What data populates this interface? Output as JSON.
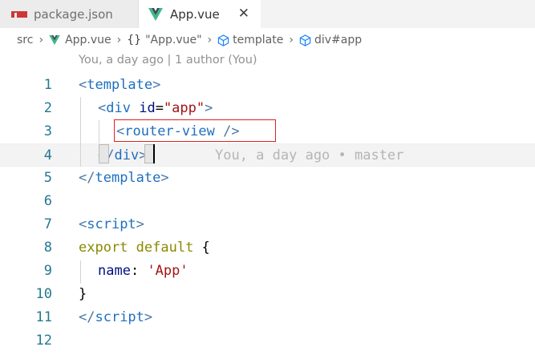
{
  "tabs": [
    {
      "label": "package.json",
      "icon": "npm-icon",
      "active": false
    },
    {
      "label": "App.vue",
      "icon": "vue-icon",
      "active": true,
      "close": "✕"
    }
  ],
  "breadcrumb": {
    "folder": "src",
    "file": "App.vue",
    "braces": "{}",
    "component": "\"App.vue\"",
    "template": "template",
    "element": "div#app"
  },
  "codelens": "You, a day ago | 1 author (You)",
  "colors": {
    "vue_green": "#41b883",
    "accent_red": "#e02020",
    "line_number": "#237893"
  },
  "lines": {
    "n1": "1",
    "n2": "2",
    "n3": "3",
    "n4": "4",
    "n5": "5",
    "n6": "6",
    "n7": "7",
    "n8": "8",
    "n9": "9",
    "n10": "10",
    "n11": "11",
    "n12": "12",
    "l1_lt": "<",
    "l1_tag": "template",
    "l1_gt": ">",
    "l2_lt": "<",
    "l2_tag": "div",
    "l2_attr": " id",
    "l2_eq": "=",
    "l2_val": "\"app\"",
    "l2_gt": ">",
    "l3_lt": "<",
    "l3_tag": "router-view",
    "l3_end": " />",
    "l4_lt": "</",
    "l4_tag": "div",
    "l4_gt": ">",
    "l4_blame": "You, a day ago • master",
    "l5_lt": "</",
    "l5_tag": "template",
    "l5_gt": ">",
    "l7_lt": "<",
    "l7_tag": "script",
    "l7_gt": ">",
    "l8_export": "export",
    "l8_default": " default",
    "l8_brace": " {",
    "l9_key": "name",
    "l9_colon": ": ",
    "l9_val": "'App'",
    "l10_brace": "}",
    "l11_lt": "</",
    "l11_tag": "script",
    "l11_gt": ">"
  }
}
